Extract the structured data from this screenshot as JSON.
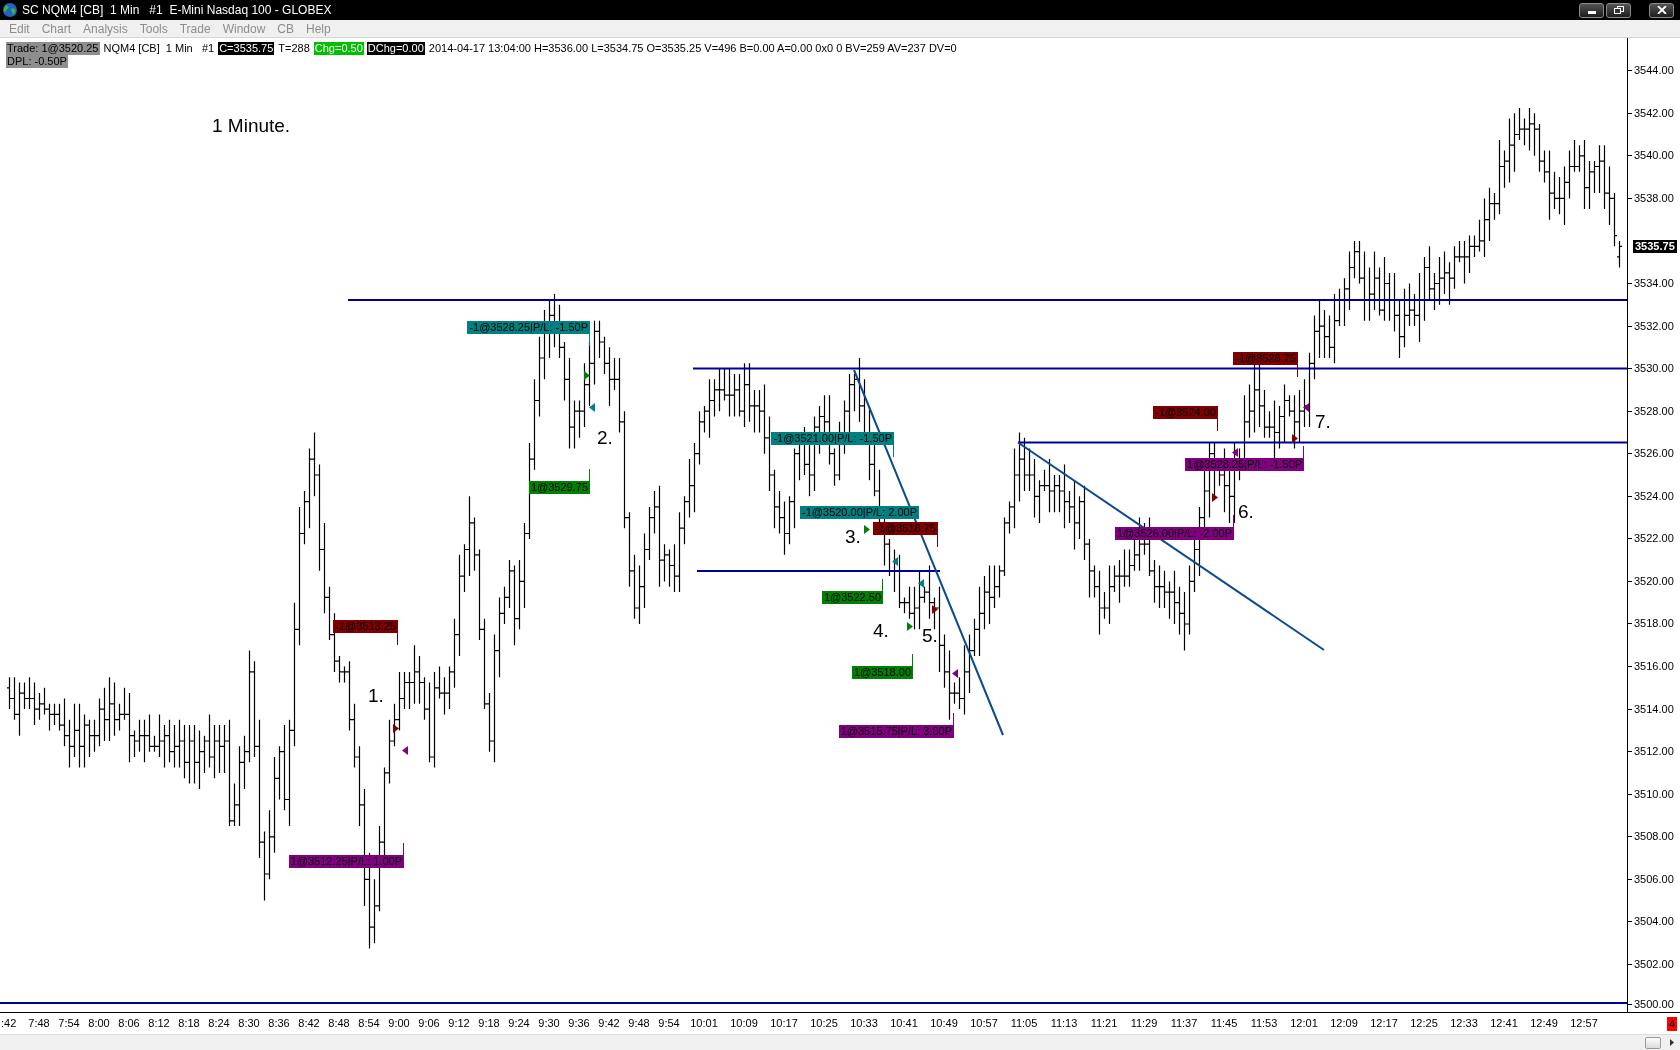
{
  "window": {
    "title": "SC NQM4 [CB]  1 Min   #1  E-Mini Nasdaq 100 - GLOBEX"
  },
  "menu": [
    {
      "label": "Edit",
      "disabled": true
    },
    {
      "label": "Chart",
      "disabled": true
    },
    {
      "label": "Analysis",
      "disabled": true
    },
    {
      "label": "Tools",
      "disabled": true
    },
    {
      "label": "Trade",
      "disabled": true
    },
    {
      "label": "Window",
      "disabled": true
    },
    {
      "label": "CB",
      "disabled": true
    },
    {
      "label": "Help",
      "disabled": true
    }
  ],
  "info_bar": {
    "lines": [
      [
        {
          "text": "Trade: 1@3520.25",
          "kind": "shaded"
        },
        {
          "text": "NQM4 [CB]  1 Min   #1",
          "kind": "plain"
        },
        {
          "text": "C=3535.75",
          "kind": "inverse"
        },
        {
          "text": "T=288",
          "kind": "plain"
        },
        {
          "text": "Chg=0.50",
          "kind": "positive"
        },
        {
          "text": "DChg=0.00",
          "kind": "inverse"
        },
        {
          "text": "2014-04-17 13:04:00 H=3536.00 L=3534.75 O=3535.25 V=496 B=0.00 A=0.00 0x0 0 BV=259 AV=237 DV=0",
          "kind": "plain"
        }
      ],
      [
        {
          "text": "DPL: -0.50P",
          "kind": "shaded"
        }
      ]
    ]
  },
  "chart": {
    "title": "1 Minute.",
    "step_labels": [
      "1.",
      "2.",
      "3.",
      "4.",
      "5.",
      "6.",
      "7."
    ],
    "trades": [
      {
        "text": "-1@3513.25",
        "color": "#800000"
      },
      {
        "text": "1@3512.25|P/L: 1.00P",
        "color": "#800080"
      },
      {
        "text": "-1@3528.25|P/L: -1.50P",
        "color": "#008080"
      },
      {
        "text": "1@3529.75",
        "color": "#008000"
      },
      {
        "text": "-1@3521.00|P/L: -1.50P",
        "color": "#008080"
      },
      {
        "text": "-1@3520.00|P/L: 2.00P",
        "color": "#008080"
      },
      {
        "text": "-1@3518.75",
        "color": "#800000"
      },
      {
        "text": "1@3522.50",
        "color": "#008000"
      },
      {
        "text": "1@3518.00",
        "color": "#008000"
      },
      {
        "text": "1@3515.75|P/L: 3.00P",
        "color": "#800080"
      },
      {
        "text": "-1@3524.00",
        "color": "#800000"
      },
      {
        "text": "-1@3526.75",
        "color": "#800000"
      },
      {
        "text": "1@3528.25|P/L: -1.50P",
        "color": "#800080"
      },
      {
        "text": "1@3526.00|P/L: -2.00P",
        "color": "#800080"
      }
    ],
    "fill_markers": [
      {
        "color": "#800000",
        "kind": "right"
      },
      {
        "color": "#800080",
        "kind": "left"
      },
      {
        "color": "#008000",
        "kind": "right"
      },
      {
        "color": "#008080",
        "kind": "left"
      },
      {
        "color": "#008000",
        "kind": "right"
      },
      {
        "color": "#008080",
        "kind": "left"
      },
      {
        "color": "#008080",
        "kind": "left"
      },
      {
        "color": "#800000",
        "kind": "right"
      },
      {
        "color": "#008000",
        "kind": "right"
      },
      {
        "color": "#800080",
        "kind": "left"
      },
      {
        "color": "#800000",
        "kind": "right"
      },
      {
        "color": "#800080",
        "kind": "left"
      },
      {
        "color": "#800000",
        "kind": "right"
      },
      {
        "color": "#800080",
        "kind": "left"
      }
    ],
    "price_axis": {
      "labels": [
        "3544.00",
        "3542.00",
        "3540.00",
        "3538.00",
        "3534.00",
        "3532.00",
        "3530.00",
        "3528.00",
        "3526.00",
        "3524.00",
        "3522.00",
        "3520.00",
        "3518.00",
        "3516.00",
        "3514.00",
        "3512.00",
        "3510.00",
        "3508.00",
        "3506.00",
        "3504.00",
        "3502.00",
        "3500.00"
      ],
      "current_price": "3535.75"
    },
    "time_axis": {
      "labels": [
        ":42",
        "7:48",
        "7:54",
        "8:00",
        "8:06",
        "8:12",
        "8:18",
        "8:24",
        "8:30",
        "8:36",
        "8:42",
        "8:48",
        "8:54",
        "9:00",
        "9:06",
        "9:12",
        "9:18",
        "9:24",
        "9:30",
        "9:36",
        "9:42",
        "9:48",
        "9:54",
        "10:01",
        "10:09",
        "10:17",
        "10:25",
        "10:33",
        "10:41",
        "10:49",
        "10:57",
        "11:05",
        "11:13",
        "11:21",
        "11:29",
        "11:37",
        "11:45",
        "11:53",
        "12:01",
        "12:09",
        "12:17",
        "12:25",
        "12:33",
        "12:41",
        "12:49",
        "12:57"
      ]
    }
  },
  "alert_count": "4"
}
